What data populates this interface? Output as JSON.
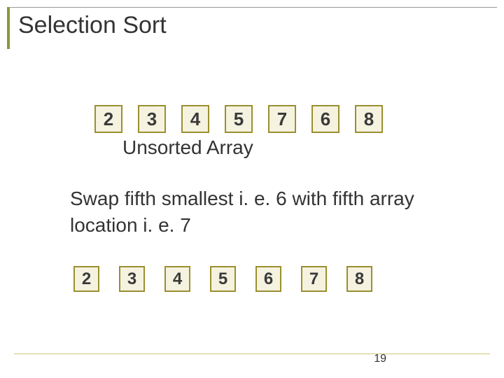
{
  "title": "Selection Sort",
  "array_top": [
    "2",
    "3",
    "4",
    "5",
    "7",
    "6",
    "8"
  ],
  "unsorted_label": "Unsorted Array",
  "instruction": "Swap fifth smallest i. e. 6 with fifth array location i. e. 7",
  "array_bottom": [
    "2",
    "3",
    "4",
    "5",
    "6",
    "7",
    "8"
  ],
  "page_number": "19"
}
